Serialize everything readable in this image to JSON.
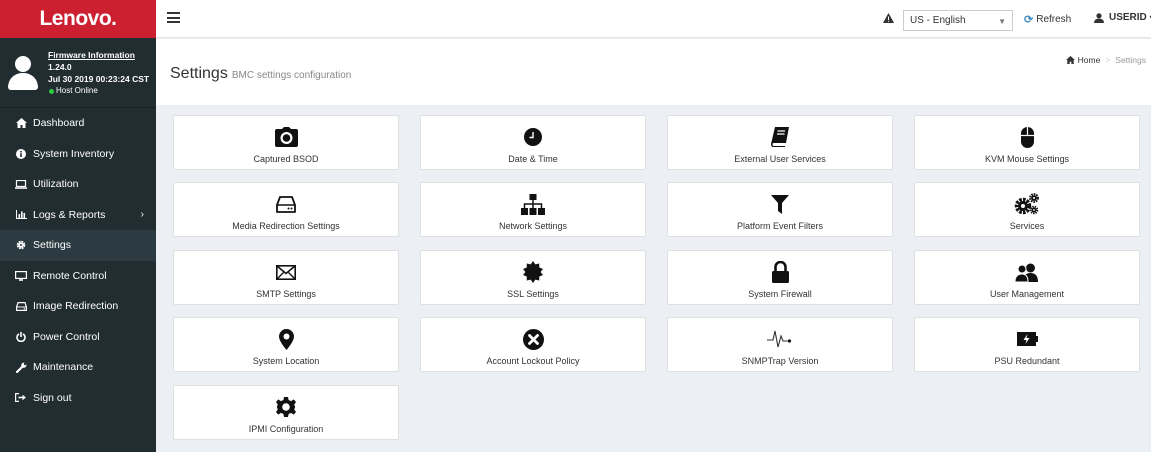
{
  "brand": {
    "logo_text": "Lenovo."
  },
  "user_panel": {
    "firmware_link": "Firmware Information",
    "version": "1.24.0",
    "build_date": "Jul 30 2019 00:23:24 CST",
    "host_status": "Host Online",
    "status_color": "#2ecc40"
  },
  "sidebar": {
    "items": [
      {
        "label": "Dashboard",
        "icon": "home-icon"
      },
      {
        "label": "System Inventory",
        "icon": "info-icon"
      },
      {
        "label": "Utilization",
        "icon": "laptop-icon"
      },
      {
        "label": "Logs & Reports",
        "icon": "bar-chart-icon",
        "has_submenu": true
      },
      {
        "label": "Settings",
        "icon": "gear-icon",
        "active": true
      },
      {
        "label": "Remote Control",
        "icon": "monitor-icon"
      },
      {
        "label": "Image Redirection",
        "icon": "hdd-icon"
      },
      {
        "label": "Power Control",
        "icon": "power-icon"
      },
      {
        "label": "Maintenance",
        "icon": "wrench-icon"
      },
      {
        "label": "Sign out",
        "icon": "sign-out-icon"
      }
    ]
  },
  "topbar": {
    "language_selected": "US - English",
    "refresh_label": "Refresh",
    "user_label": "USERID"
  },
  "content_header": {
    "title": "Settings",
    "subtitle": "BMC settings configuration",
    "breadcrumb_home": "Home",
    "breadcrumb_current": "Settings"
  },
  "tiles": [
    {
      "label": "Captured BSOD",
      "icon": "camera-icon"
    },
    {
      "label": "Date & Time",
      "icon": "clock-icon"
    },
    {
      "label": "External User Services",
      "icon": "book-icon"
    },
    {
      "label": "KVM Mouse Settings",
      "icon": "mouse-icon"
    },
    {
      "label": "Media Redirection Settings",
      "icon": "hdd-icon"
    },
    {
      "label": "Network Settings",
      "icon": "sitemap-icon"
    },
    {
      "label": "Platform Event Filters",
      "icon": "filter-icon"
    },
    {
      "label": "Services",
      "icon": "cogs-icon"
    },
    {
      "label": "SMTP Settings",
      "icon": "envelope-icon"
    },
    {
      "label": "SSL Settings",
      "icon": "certificate-icon"
    },
    {
      "label": "System Firewall",
      "icon": "lock-icon"
    },
    {
      "label": "User Management",
      "icon": "users-icon"
    },
    {
      "label": "System Location",
      "icon": "map-marker-icon"
    },
    {
      "label": "Account Lockout Policy",
      "icon": "times-circle-icon"
    },
    {
      "label": "SNMPTrap Version",
      "icon": "pulse-icon"
    },
    {
      "label": "PSU Redundant",
      "icon": "battery-bolt-icon"
    },
    {
      "label": "IPMI Configuration",
      "icon": "cog-icon"
    }
  ],
  "colors": {
    "brand_red": "#cc1f2f",
    "sidebar_bg": "#222d32",
    "sidebar_active": "#2c3b41",
    "accent": "#3c8dbc"
  }
}
